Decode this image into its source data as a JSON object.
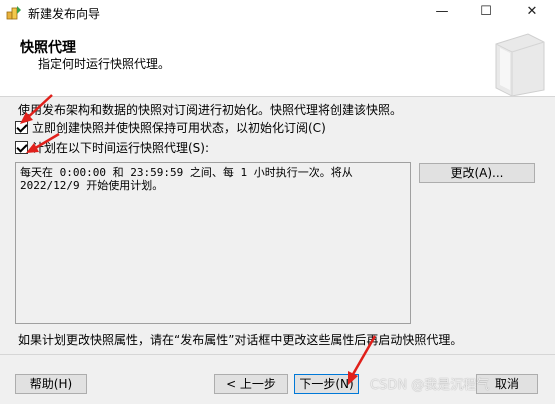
{
  "window": {
    "title": "新建发布向导",
    "minimize": "—",
    "maximize": "☐",
    "close": "✕"
  },
  "header": {
    "title": "快照代理",
    "subtitle": "指定何时运行快照代理。"
  },
  "intro": "使用发布架构和数据的快照对订阅进行初始化。快照代理将创建该快照。",
  "options": {
    "immediate_label": "立即创建快照并使快照保持可用状态，以初始化订阅(C)",
    "immediate_checked": true,
    "schedule_label": "计划在以下时间运行快照代理(S):",
    "schedule_checked": true
  },
  "schedule_text": "每天在 0:00:00 和 23:59:59 之间、每 1 小时执行一次。将从\n2022/12/9 开始使用计划。",
  "change_button": "更改(A)...",
  "footnote": "如果计划更改快照属性，请在“发布属性”对话框中更改这些属性后再启动快照代理。",
  "buttons": {
    "help": "帮助(H)",
    "back": "< 上一步",
    "next": "下一步(N)",
    "cancel": "取消"
  },
  "watermark": "CSDN @我是沉程气",
  "colors": {
    "arrow": "#e0201b",
    "focus_border": "#0078d7"
  }
}
